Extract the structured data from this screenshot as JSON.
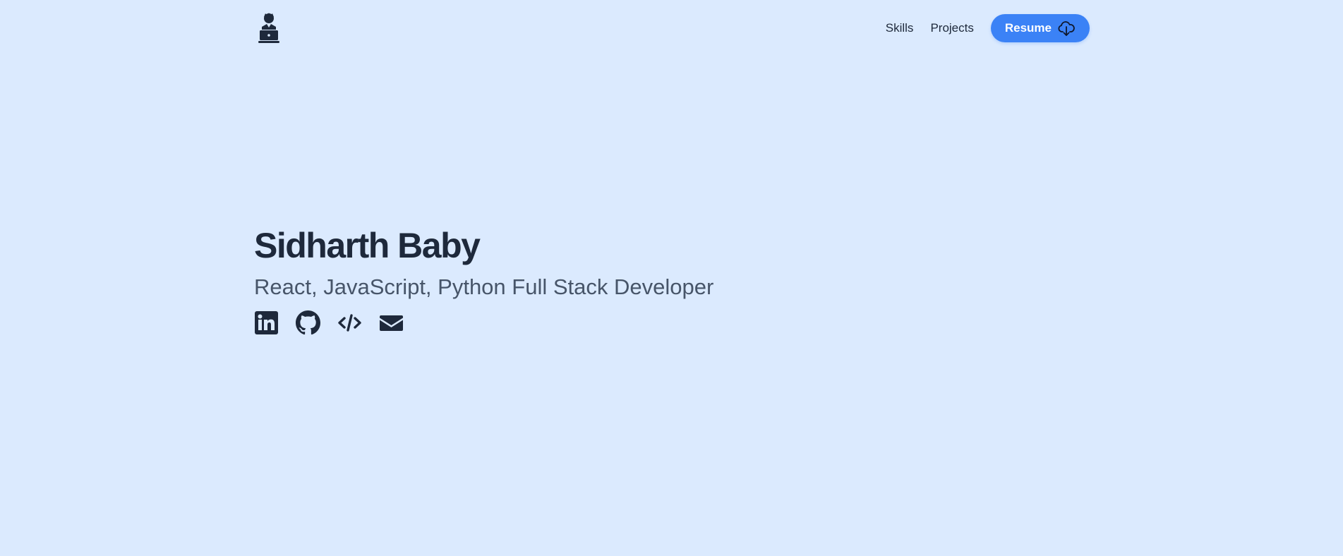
{
  "header": {
    "logo_icon": "developer-at-laptop-icon",
    "nav": {
      "skills": "Skills",
      "projects": "Projects"
    },
    "resume_button": {
      "label": "Resume",
      "icon": "cloud-download-icon",
      "color": "#3b82f6"
    }
  },
  "hero": {
    "name": "Sidharth Baby",
    "tagline": "React, JavaScript, Python Full Stack Developer",
    "socials": [
      {
        "icon": "linkedin-icon"
      },
      {
        "icon": "github-icon"
      },
      {
        "icon": "code-icon"
      },
      {
        "icon": "envelope-icon"
      }
    ]
  },
  "colors": {
    "background": "#dbeafe",
    "text_primary": "#1e293b",
    "text_secondary": "#475569"
  }
}
